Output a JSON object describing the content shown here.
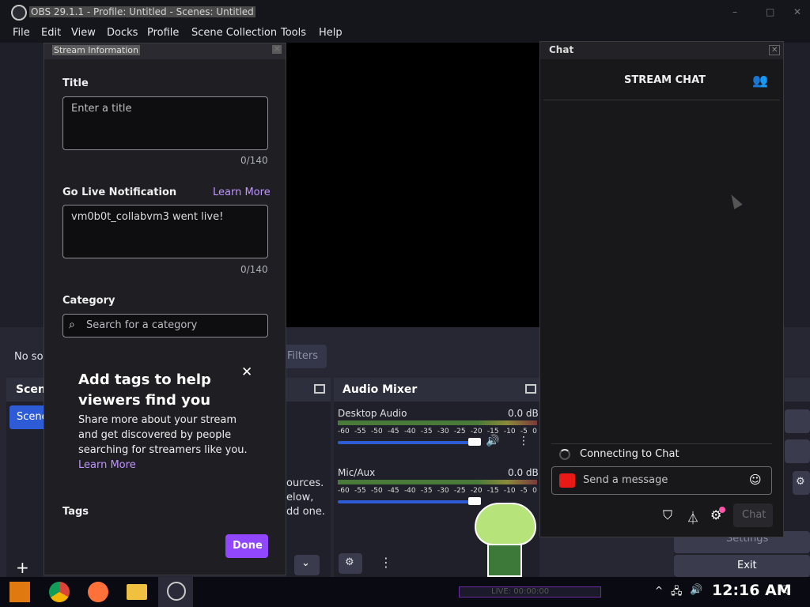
{
  "window": {
    "title": "OBS 29.1.1 - Profile: Untitled - Scenes: Untitled"
  },
  "menu": [
    "File",
    "Edit",
    "View",
    "Docks",
    "Profile",
    "Scene Collection",
    "Tools",
    "Help"
  ],
  "main": {
    "no_source_text": "No so",
    "filters_label": "Filters",
    "scenes_title": "Scen",
    "scene_item": "Scene",
    "sources_hint": [
      "ources.",
      "elow,",
      "dd one."
    ],
    "audio_mixer": {
      "title": "Audio Mixer",
      "channels": [
        {
          "name": "Desktop Audio",
          "db": "0.0 dB"
        },
        {
          "name": "Mic/Aux",
          "db": "0.0 dB"
        }
      ],
      "scale": [
        "-60",
        "-55",
        "-50",
        "-45",
        "-40",
        "-35",
        "-30",
        "-25",
        "-20",
        "-15",
        "-10",
        "-5",
        "0"
      ]
    },
    "controls": {
      "settings": "Settings",
      "exit": "Exit"
    }
  },
  "stream_info": {
    "dock_title": "Stream Information",
    "title_label": "Title",
    "title_placeholder": "Enter a title",
    "title_count": "0/140",
    "notification_label": "Go Live Notification",
    "learn_more": "Learn More",
    "notification_value": "vm0b0t_collabvm3 went live!",
    "notification_count": "0/140",
    "category_label": "Category",
    "category_placeholder": "Search for a category",
    "tags_promo": {
      "heading": "Add tags to help viewers find you",
      "body": "Share more about your stream and get discovered by people searching for streamers like you.",
      "link": "Learn More"
    },
    "tags_label": "Tags",
    "done_button": "Done"
  },
  "chat": {
    "dock_title": "Chat",
    "header": "STREAM CHAT",
    "connecting": "Connecting to Chat",
    "input_placeholder": "Send a message",
    "send_button": "Chat"
  },
  "taskbar": {
    "live_text": "LIVE: 00:00:00",
    "clock": "12:16 AM"
  },
  "colors": {
    "accent": "#9147ff",
    "link": "#bf94ff",
    "obs_blue": "#2e5bd6"
  }
}
